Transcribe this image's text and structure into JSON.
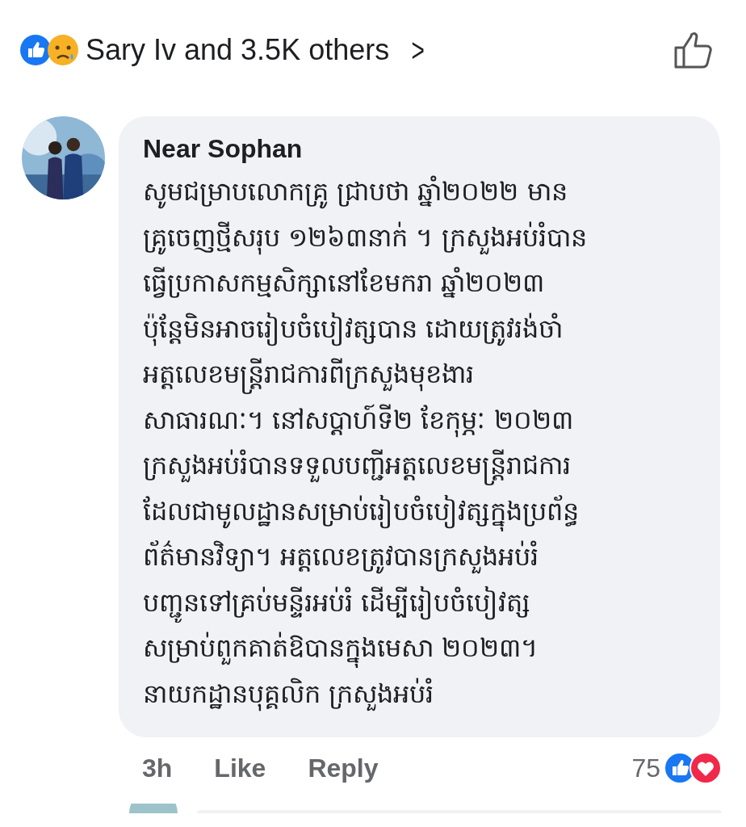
{
  "reactions_summary": {
    "text": "Sary Iv and 3.5K others",
    "chevron": ">"
  },
  "comment": {
    "author": "Near Sophan",
    "body_lines": [
      "សូមជម្រាបលោកគ្រូ ជ្រាបថា ឆ្នាំ២០២២ មាន",
      "គ្រូចេញថ្មីសរុប ១២៦៣នាក់ ។ ក្រសួងអប់រំបាន",
      "ធ្វើប្រកាសកម្មសិក្សានៅខែមករា ឆ្នាំ២០២៣",
      "ប៉ុន្តែមិនអាចរៀបចំបៀវត្សបាន ដោយត្រូវរង់ចាំ",
      "អត្តលេខមន្ត្រីរាជការពីក្រសួងមុខងារ",
      "សាធារណៈ។ នៅសប្តាហ៍ទី២ ខែកុម្ភៈ ២០២៣",
      "ក្រសួងអប់រំបានទទួលបញ្ជីអត្តលេខមន្ត្រីរាជការ",
      "ដែលជាមូលដ្ឋានសម្រាប់រៀបចំបៀវត្សក្នុងប្រព័ន្ធ",
      "ព័ត៌មានវិទ្យា។ អត្តលេខត្រូវបានក្រសួងអប់រំ",
      "បញ្ជូនទៅគ្រប់មន្ទីរអប់រំ ដើម្បីរៀបចំបៀវត្ស",
      "សម្រាប់ពួកគាត់ឱបានក្នុងមេសា ២០២៣។",
      "នាយកដ្ឋានបុគ្គលិក ក្រសួងអប់រំ"
    ],
    "time": "3h",
    "actions": [
      "Like",
      "Reply"
    ],
    "reaction_count": "75"
  }
}
